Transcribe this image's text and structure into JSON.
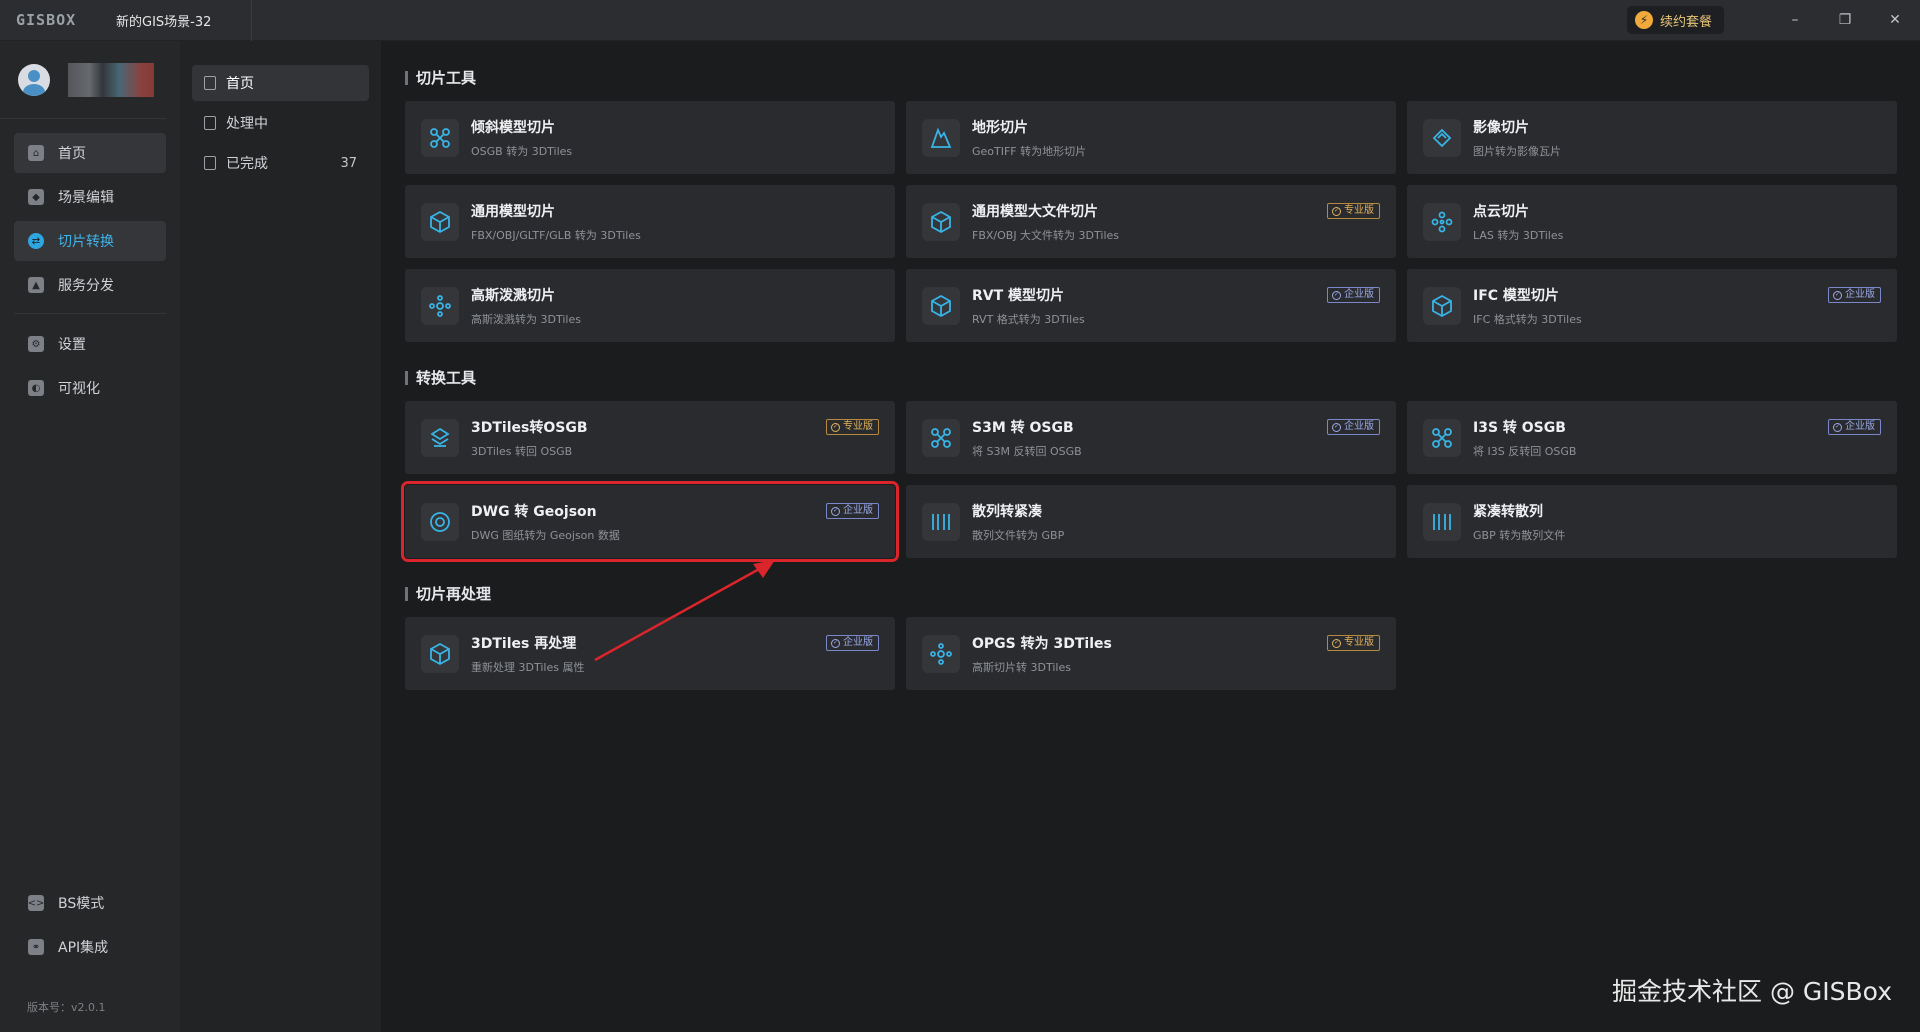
{
  "app": {
    "logo": "GISBOX",
    "tab_title": "新的GIS场景-32",
    "renew_label": "续约套餐"
  },
  "window": {
    "minimize": "–",
    "restore": "❐",
    "close": "✕"
  },
  "sidebar": {
    "items": [
      {
        "label": "首页",
        "icon": "home-icon"
      },
      {
        "label": "场景编辑",
        "icon": "cube-icon"
      },
      {
        "label": "切片转换",
        "icon": "swap-icon"
      },
      {
        "label": "服务分发",
        "icon": "upload-icon"
      },
      {
        "label": "设置",
        "icon": "gear-icon"
      },
      {
        "label": "可视化",
        "icon": "visual-icon"
      }
    ],
    "bottom_items": [
      {
        "label": "BS模式",
        "icon": "code-icon"
      },
      {
        "label": "API集成",
        "icon": "link-icon"
      }
    ],
    "version": "版本号：v2.0.1"
  },
  "subbar": {
    "items": [
      {
        "label": "首页",
        "count": ""
      },
      {
        "label": "处理中",
        "count": ""
      },
      {
        "label": "已完成",
        "count": "37"
      }
    ]
  },
  "sections": [
    {
      "title": "切片工具"
    },
    {
      "title": "转换工具"
    },
    {
      "title": "切片再处理"
    }
  ],
  "badges": {
    "pro": "专业版",
    "ent": "企业版"
  },
  "cards": [
    {
      "name": "倾斜模型切片",
      "desc": "OSGB 转为 3DTiles",
      "badge": ""
    },
    {
      "name": "地形切片",
      "desc": "GeoTIFF 转为地形切片",
      "badge": ""
    },
    {
      "name": "影像切片",
      "desc": "图片转为影像瓦片",
      "badge": ""
    },
    {
      "name": "通用模型切片",
      "desc": "FBX/OBJ/GLTF/GLB 转为 3DTiles",
      "badge": ""
    },
    {
      "name": "通用模型大文件切片",
      "desc": "FBX/OBJ 大文件转为 3DTiles",
      "badge": "pro"
    },
    {
      "name": "点云切片",
      "desc": "LAS 转为 3DTiles",
      "badge": ""
    },
    {
      "name": "高斯泼溅切片",
      "desc": "高斯泼溅转为 3DTiles",
      "badge": ""
    },
    {
      "name": "RVT 模型切片",
      "desc": "RVT 格式转为 3DTiles",
      "badge": "ent"
    },
    {
      "name": "IFC 模型切片",
      "desc": "IFC 格式转为 3DTiles",
      "badge": "ent"
    },
    {
      "name": "3DTiles转OSGB",
      "desc": "3DTiles 转回 OSGB",
      "badge": "pro"
    },
    {
      "name": "S3M 转 OSGB",
      "desc": "将 S3M 反转回 OSGB",
      "badge": "ent"
    },
    {
      "name": "I3S 转 OSGB",
      "desc": "将 I3S 反转回 OSGB",
      "badge": "ent"
    },
    {
      "name": "DWG 转 Geojson",
      "desc": "DWG 图纸转为 Geojson 数据",
      "badge": "ent"
    },
    {
      "name": "散列转紧凑",
      "desc": "散列文件转为 GBP",
      "badge": ""
    },
    {
      "name": "紧凑转散列",
      "desc": "GBP 转为散列文件",
      "badge": ""
    },
    {
      "name": "3DTiles 再处理",
      "desc": "重新处理 3DTiles 属性",
      "badge": "ent"
    },
    {
      "name": "OPGS 转为 3DTiles",
      "desc": "高斯切片转 3DTiles",
      "badge": "pro"
    }
  ],
  "watermark": "掘金技术社区 @ GISBox",
  "colors": {
    "accent": "#2fa6e0",
    "highlight": "#d9252b",
    "pro": "#e0b25c",
    "enterprise": "#9aa9e6"
  }
}
